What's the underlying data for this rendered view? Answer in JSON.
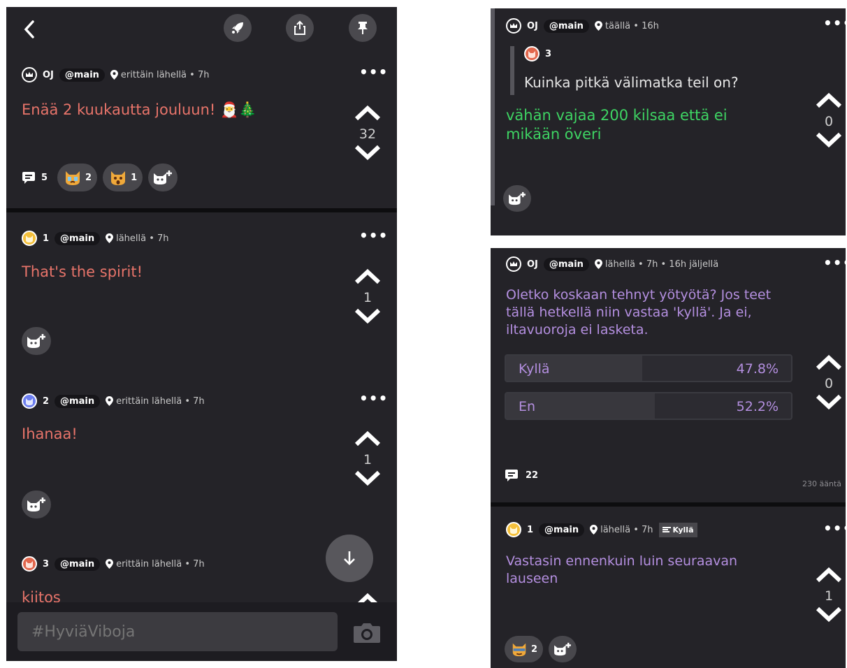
{
  "colors": {
    "red_text": "#e8746a",
    "green_text": "#3ed463",
    "purple_text": "#b48fe0",
    "bg": "#242328"
  },
  "left": {
    "header": {
      "back_icon": "chevron-left-icon",
      "buttons": [
        "rocket-icon",
        "share-icon",
        "pin-icon"
      ]
    },
    "op": {
      "handle": "OJ",
      "channel": "@main",
      "location": "erittäin lähellä • 7h",
      "text": "Enää 2 kuukautta jouluun! 🎅🎄",
      "votes": "32",
      "comments": "5",
      "reactions": [
        {
          "count": "2"
        },
        {
          "count": "1"
        }
      ]
    },
    "replies": [
      {
        "num": "1",
        "channel": "@main",
        "location": "lähellä • 7h",
        "text": "That's the spirit!",
        "votes": "1"
      },
      {
        "num": "2",
        "channel": "@main",
        "location": "erittäin lähellä • 7h",
        "text": "Ihanaa!",
        "votes": "1"
      },
      {
        "num": "3",
        "channel": "@main",
        "location": "erittäin lähellä • 7h",
        "text": "kiitos"
      }
    ],
    "composer": {
      "placeholder": "#HyviäViboja"
    }
  },
  "r1": {
    "handle": "OJ",
    "channel": "@main",
    "location": "täällä • 16h",
    "quote_num": "3",
    "quote_text": "Kuinka pitkä välimatka teil on?",
    "text": "vähän vajaa 200 kilsaa että ei mikään överi",
    "votes": "0"
  },
  "r2": {
    "handle": "OJ",
    "channel": "@main",
    "location": "lähellä • 7h • 16h jäljellä",
    "text": "Oletko koskaan tehnyt yötyötä? Jos teet tällä hetkellä niin vastaa 'kyllä'. Ja ei, iltavuoroja ei lasketa.",
    "options": [
      {
        "label": "Kyllä",
        "percent": "47.8%",
        "share": 0.478
      },
      {
        "label": "En",
        "percent": "52.2%",
        "share": 0.522
      }
    ],
    "votes": "0",
    "comments": "22",
    "total_votes": "230 ääntä"
  },
  "r3": {
    "num": "1",
    "channel": "@main",
    "location": "lähellä • 7h",
    "answer": "Kyllä",
    "text": "Vastasin ennenkuin luin seuraavan lauseen",
    "votes": "1",
    "reactions": [
      {
        "count": "2"
      }
    ]
  }
}
